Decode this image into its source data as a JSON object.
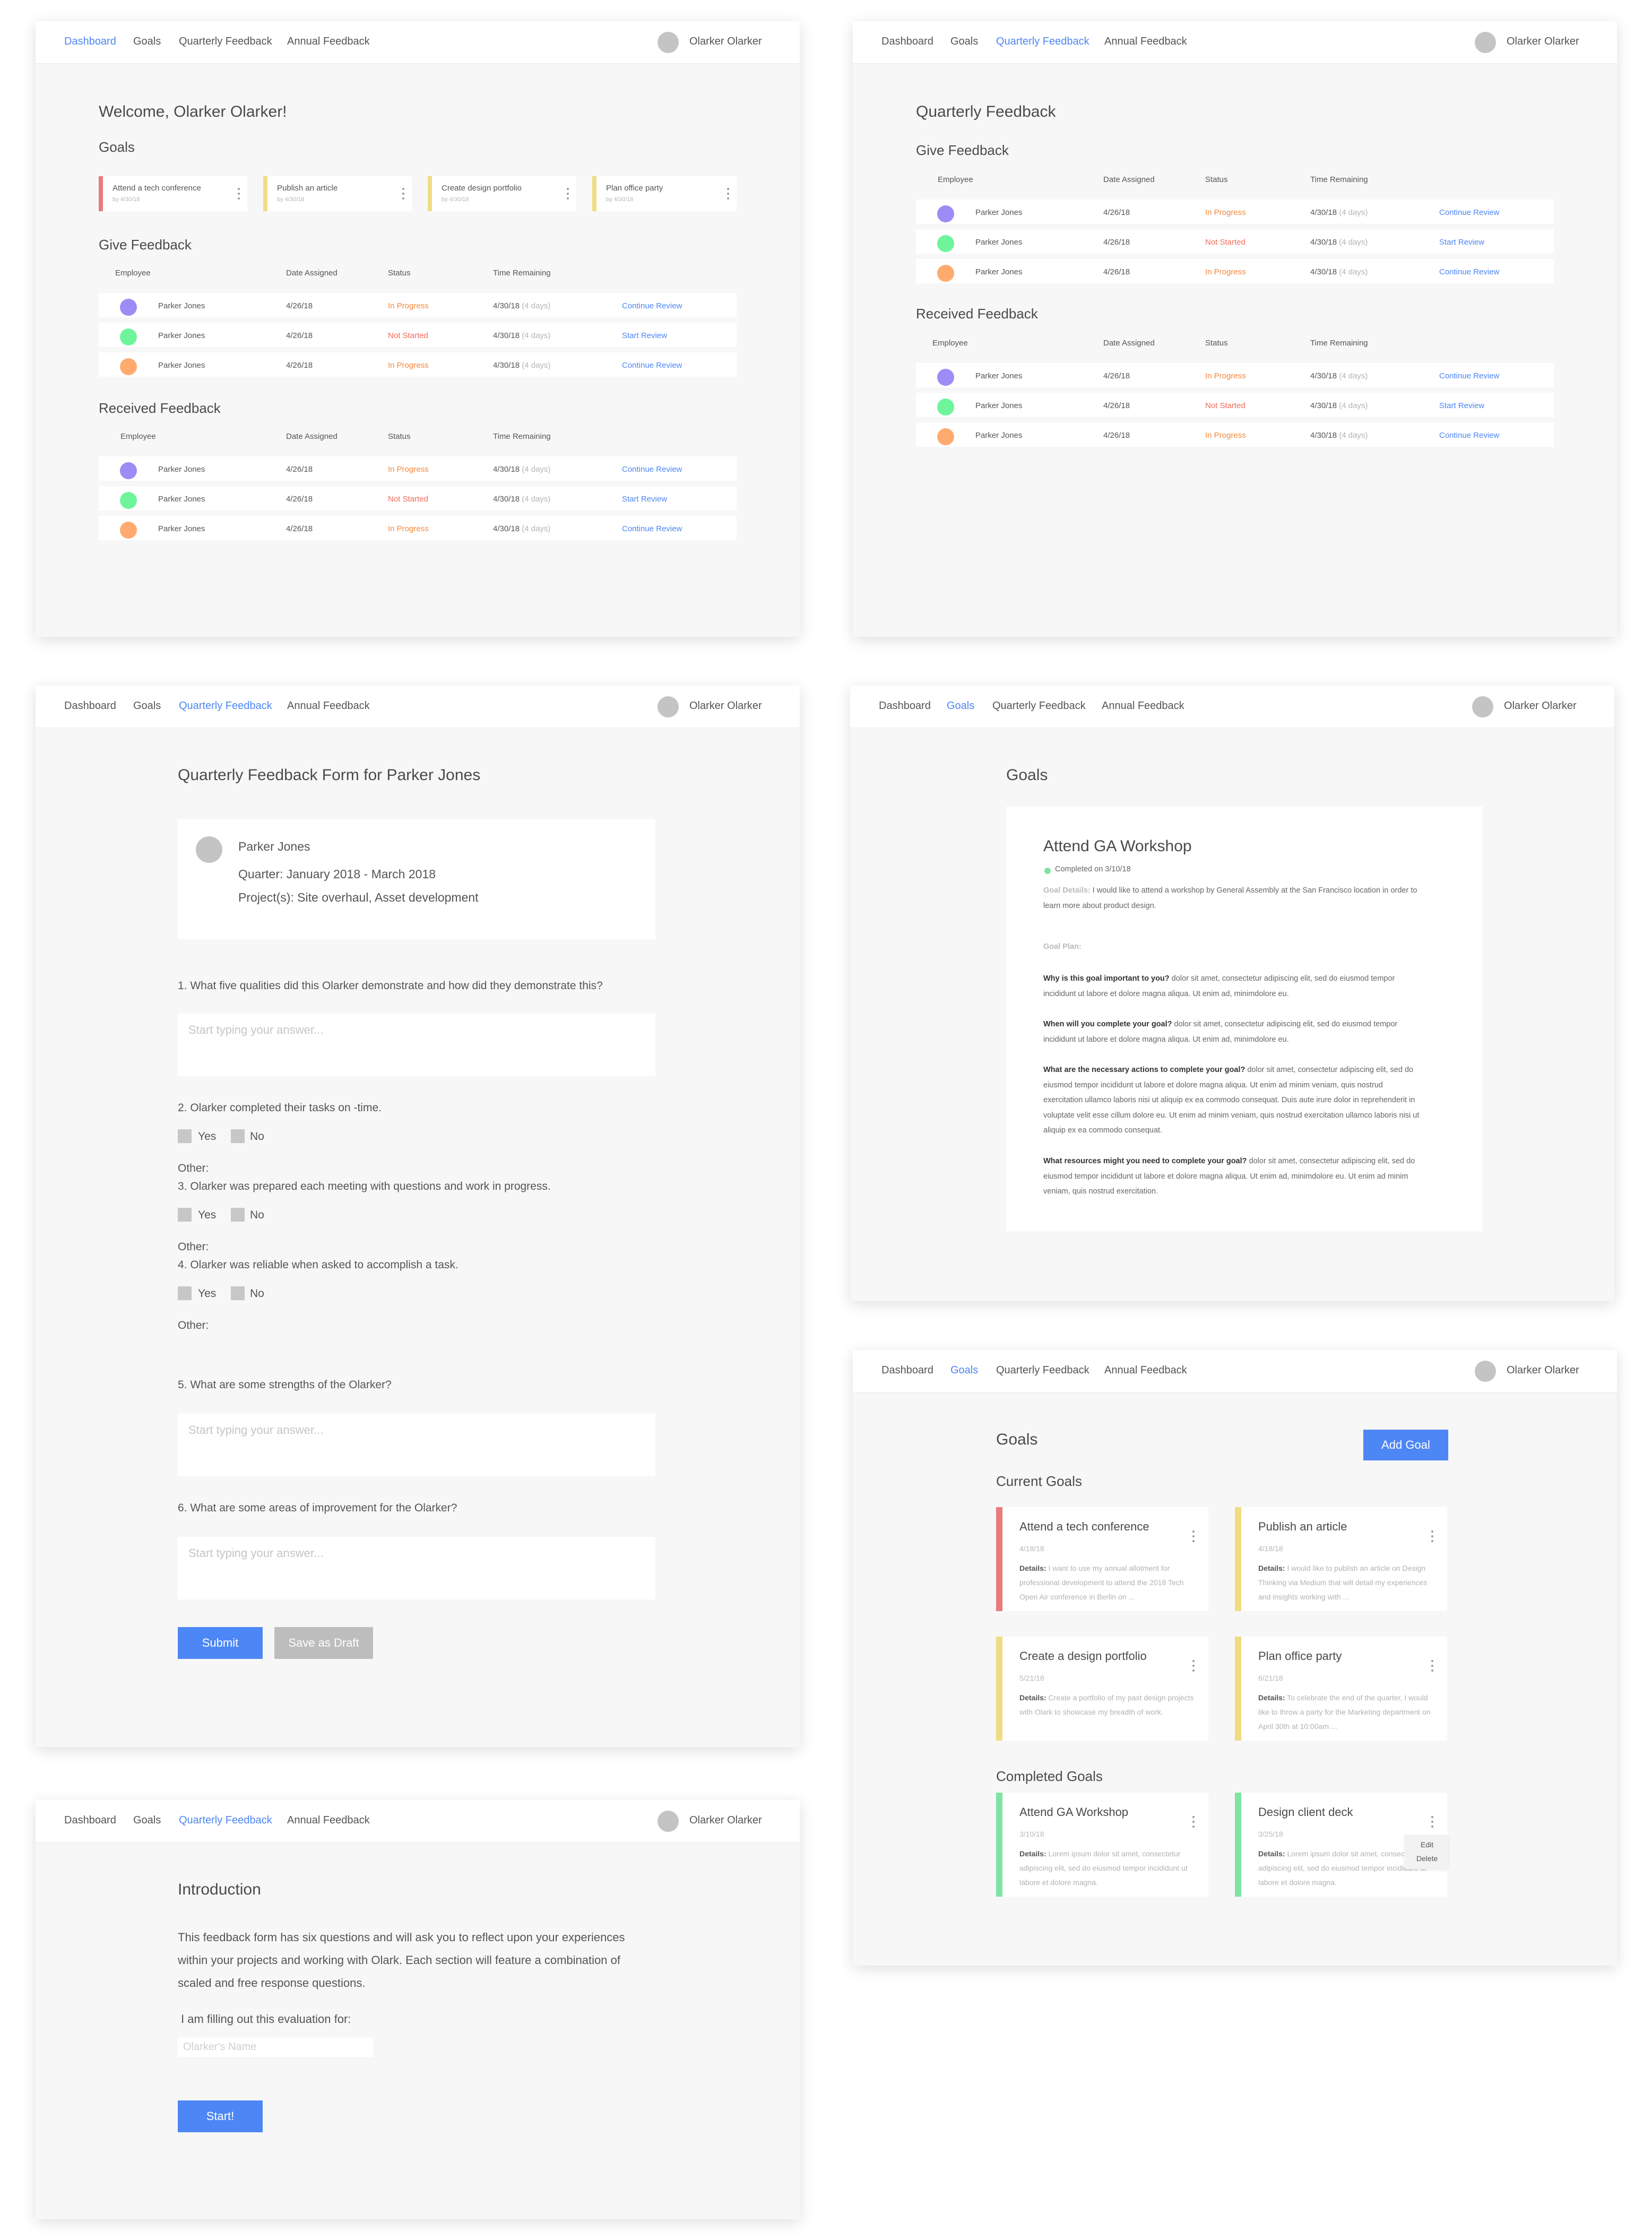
{
  "nav": {
    "dashboard": "Dashboard",
    "goals": "Goals",
    "quarterly": "Quarterly Feedback",
    "annual": "Annual Feedback",
    "user": "Olarker Olarker"
  },
  "colors": {
    "accent": "#4d86f5",
    "in_progress": "#f6883a",
    "not_started": "#f26b5b",
    "goal_red": "#e97b7b",
    "goal_yellow": "#f0dc82",
    "goal_green": "#7fe3a4",
    "avatar_purple": "#9c8cf5",
    "avatar_green": "#6ef59c",
    "avatar_orange": "#ffab70"
  },
  "table": {
    "employee": "Employee",
    "date_assigned": "Date Assigned",
    "status": "Status",
    "time_remaining": "Time Remaining",
    "rows": [
      {
        "name": "Parker Jones",
        "date": "4/26/18",
        "status": "In Progress",
        "due": "4/30/18",
        "left": "(4 days)",
        "action": "Continue Review"
      },
      {
        "name": "Parker Jones",
        "date": "4/26/18",
        "status": "Not Started",
        "due": "4/30/18",
        "left": "(4 days)",
        "action": "Start Review"
      },
      {
        "name": "Parker Jones",
        "date": "4/26/18",
        "status": "In Progress",
        "due": "4/30/18",
        "left": "(4 days)",
        "action": "Continue Review"
      }
    ]
  },
  "dashboard": {
    "welcome": "Welcome, Olarker Olarker!",
    "goals_title": "Goals",
    "goals": [
      {
        "title": "Attend a tech conference",
        "sub": "by 4/30/18"
      },
      {
        "title": "Publish an article",
        "sub": "by 4/30/18"
      },
      {
        "title": "Create design portfolio",
        "sub": "by 4/30/18"
      },
      {
        "title": "Plan office party",
        "sub": "by 4/30/18"
      }
    ],
    "give_feedback": "Give Feedback",
    "received_feedback": "Received Feedback"
  },
  "quarterly": {
    "title": "Quarterly Feedback",
    "give_feedback": "Give Feedback",
    "received_feedback": "Received Feedback"
  },
  "form": {
    "title": "Quarterly Feedback Form for Parker Jones",
    "name": "Parker Jones",
    "quarter": "Quarter: January 2018 - March 2018",
    "projects": "Project(s): Site overhaul, Asset development",
    "q1": "1. What five qualities did this Olarker demonstrate and how did they demonstrate this?",
    "placeholder": "Start typing your answer...",
    "q2": "2. Olarker completed their tasks on -time.",
    "q3": "3. Olarker was prepared each meeting with questions and work in progress.",
    "q4": "4. Olarker was reliable when asked to accomplish a task.",
    "yes": "Yes",
    "no": "No",
    "other": "Other:",
    "q5": "5. What are some strengths of the Olarker?",
    "q6": "6. What are some areas of improvement for the Olarker?",
    "submit": "Submit",
    "draft": "Save as Draft"
  },
  "intro": {
    "title": "Introduction",
    "para": "This feedback form has six questions and will ask you to reflect upon your experiences within your projects and working with Olark. Each section will feature a combination of scaled and free response questions.",
    "filling": "I am filling out this evaluation for:",
    "name_placeholder": "Olarker's Name",
    "start": "Start!"
  },
  "goal_detail": {
    "page_title": "Goals",
    "title": "Attend GA Workshop",
    "completed": "Completed on 3/10/18",
    "details_label": "Goal Details:",
    "details": "I would like to attend a workshop by General Assembly at the San Francisco location in order to learn more about product design.",
    "plan_label": "Goal Plan:",
    "q_why": "Why is this goal important to you?",
    "a_why": "dolor sit amet, consectetur adipiscing elit, sed do eiusmod tempor incididunt ut labore et dolore magna aliqua. Ut enim ad, minimdolore eu.",
    "q_when": "When will you complete your goal?",
    "a_when": "dolor sit amet, consectetur adipiscing elit, sed do eiusmod tempor incididunt ut labore et dolore magna aliqua. Ut enim ad, minimdolore eu.",
    "q_actions": "What are the necessary actions to complete your goal?",
    "a_actions": "dolor sit amet, consectetur adipiscing elit, sed do eiusmod tempor incididunt ut labore et dolore magna aliqua. Ut enim ad minim veniam, quis nostrud exercitation ullamco laboris nisi ut aliquip ex ea commodo consequat. Duis aute irure dolor in reprehenderit in voluptate velit esse cillum dolore eu. Ut enim ad minim veniam, quis nostrud exercitation ullamco laboris nisi ut aliquip ex ea commodo consequat.",
    "q_resources": "What resources might you need to complete your goal?",
    "a_resources": "dolor sit amet, consectetur adipiscing elit, sed do eiusmod tempor incididunt ut labore et dolore magna aliqua. Ut enim ad, minimdolore eu. Ut enim ad minim veniam, quis nostrud exercitation."
  },
  "goals_page": {
    "title": "Goals",
    "add": "Add Goal",
    "current": "Current Goals",
    "completed": "Completed Goals",
    "details_label": "Details:",
    "edit": "Edit",
    "delete": "Delete",
    "cards": [
      {
        "title": "Attend a tech conference",
        "date": "4/18/18",
        "details": "I want to use my annual allotment for professional development to attend the 2018 Tech Open Air conference in Berlin on ..."
      },
      {
        "title": "Publish an article",
        "date": "4/18/18",
        "details": "I would like to publish an article on Design Thinking via Medium that will detail my experiences and insights working with ..."
      },
      {
        "title": "Create a design portfolio",
        "date": "5/21/18",
        "details": "Create a portfolio of my past design projects with Olark to showcase my breadth of work."
      },
      {
        "title": "Plan office party",
        "date": "6/21/18",
        "details": "To celebrate the end of the quarter, I would like to throw a party for the Marketing department on April 30th at 10:00am ..."
      },
      {
        "title": "Attend GA Workshop",
        "date": "3/10/18",
        "details": "Lorem ipsum dolor sit amet, consectetur adipiscing elit, sed do eiusmod tempor incididunt ut labore et dolore magna."
      },
      {
        "title": "Design client deck",
        "date": "3/25/18",
        "details": "Lorem ipsum dolor sit amet, consectetur adipiscing elit, sed do eiusmod tempor incididunt ut labore et dolore magna."
      }
    ]
  }
}
